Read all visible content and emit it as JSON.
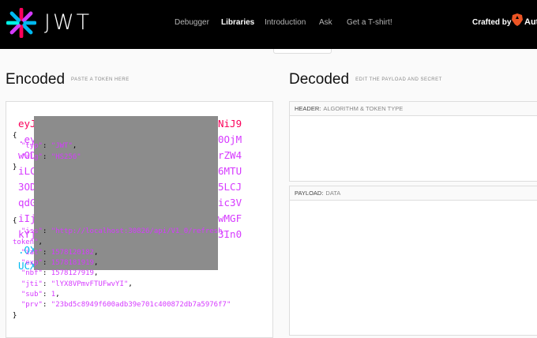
{
  "brand": "JWT",
  "nav": [
    "Debugger",
    "Libraries",
    "Introduction",
    "Ask",
    "Get a T-shirt!"
  ],
  "crafted_by": "Crafted by",
  "auth0_text": "Aut",
  "encoded": {
    "title": "Encoded",
    "subtitle": "PASTE A TOKEN HERE"
  },
  "decoded": {
    "title": "Decoded",
    "subtitle": "EDIT THE PAYLOAD AND SECRET"
  },
  "token_lines": [
    {
      "left": "eyJ",
      "right": "NiJ9",
      "color": "#fb015b"
    },
    {
      "left": ".ey",
      "right": "0OjM",
      "color": "#d63aff"
    },
    {
      "left": "wOD",
      "right": "rZW4",
      "color": "#d63aff"
    },
    {
      "left": "iLC",
      "right": "6MTU",
      "color": "#d63aff"
    },
    {
      "left": "3OD",
      "right": "5LCJ",
      "color": "#d63aff"
    },
    {
      "left": "qdG",
      "right": "ic3V",
      "color": "#d63aff"
    },
    {
      "left": "iIj",
      "right": "wMGF",
      "color": "#d63aff"
    },
    {
      "left": "kYj",
      "right": "3In0",
      "color": "#d63aff"
    },
    {
      "left": ".OX",
      "right": "",
      "color": "#00b9f1"
    },
    {
      "left": "UCX",
      "right": "",
      "color": "#00b9f1"
    }
  ],
  "header_panel": {
    "label": "HEADER:",
    "desc": "ALGORITHM & TOKEN TYPE"
  },
  "payload_panel": {
    "label": "PAYLOAD:",
    "desc": "DATA"
  },
  "header_json": {
    "typ": "\"JWT\"",
    "alg": "\"HS256\""
  },
  "payload_json": {
    "iss_1": "\"http://localhost:30826/api/V1_0/refresh-",
    "iss_2": "token\"",
    "iat": "1578120182",
    "exp": "1578181919",
    "nbf": "1578127919",
    "jti": "\"lYX8VPmvFTUFwvYI\"",
    "sub": "1",
    "prv": "\"23bd5c8949f600adb39e701c400872db7a5976f7\""
  }
}
